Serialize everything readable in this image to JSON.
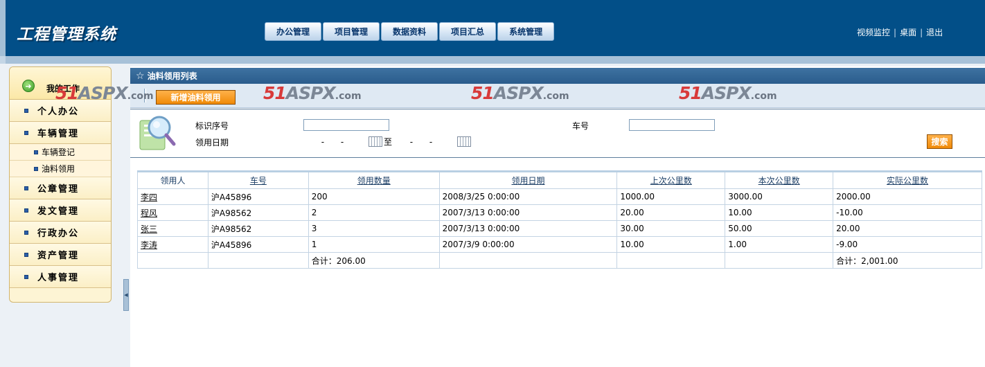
{
  "header": {
    "logo": "工程管理系统",
    "nav": [
      "办公管理",
      "项目管理",
      "数据资料",
      "项目汇总",
      "系统管理"
    ],
    "links": [
      "视频监控",
      "桌面",
      "退出"
    ],
    "separator": "|"
  },
  "sidebar": {
    "title": "我的工作",
    "items": [
      {
        "label": "个人办公"
      },
      {
        "label": "车辆管理",
        "sub": [
          "车辆登记",
          "油料领用"
        ]
      },
      {
        "label": "公章管理"
      },
      {
        "label": "发文管理"
      },
      {
        "label": "行政办公"
      },
      {
        "label": "资产管理"
      },
      {
        "label": "人事管理"
      }
    ]
  },
  "content": {
    "title": "油料领用列表",
    "add_label": "新增油料领用",
    "watermark": {
      "num": "51",
      "mid": "ASPX",
      "suffix": ".com"
    },
    "search": {
      "id_label": "标识序号",
      "car_label": "车号",
      "date_label": "领用日期",
      "date_placeholder": "- -",
      "to_label": "至",
      "button": "搜索"
    },
    "table": {
      "headers": [
        "领用人",
        "车号",
        "领用数量",
        "领用日期",
        "上次公里数",
        "本次公里数",
        "实际公里数"
      ],
      "rows": [
        [
          "李四",
          "沪A45896",
          "200",
          "2008/3/25 0:00:00",
          "1000.00",
          "3000.00",
          "2000.00"
        ],
        [
          "程风",
          "沪A98562",
          "2",
          "2007/3/13 0:00:00",
          "20.00",
          "10.00",
          "-10.00"
        ],
        [
          "张三",
          "沪A98562",
          "3",
          "2007/3/13 0:00:00",
          "30.00",
          "50.00",
          "20.00"
        ],
        [
          "李涛",
          "沪A45896",
          "1",
          "2007/3/9 0:00:00",
          "10.00",
          "1.00",
          "-9.00"
        ]
      ],
      "total_qty": "合计：206.00",
      "total_km": "合计：2,001.00"
    }
  },
  "colors": {
    "header_bg": "#024f88",
    "accent_orange": "#f08a07",
    "sidebar_bg": "#fdf4d4"
  }
}
